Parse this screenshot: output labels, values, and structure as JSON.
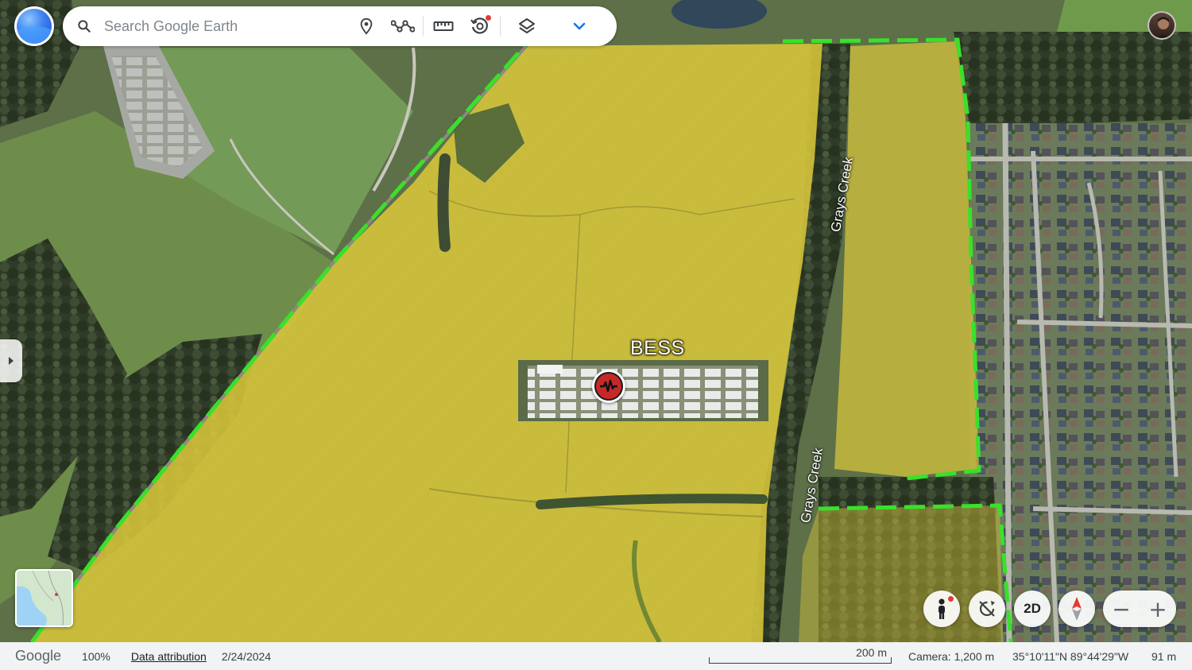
{
  "search": {
    "placeholder": "Search Google Earth"
  },
  "toolbar": {
    "placemark_icon": "pin-icon",
    "path_icon": "path-icon",
    "measure_icon": "ruler-icon",
    "history_icon": "history-icon",
    "layers_icon": "layers-icon",
    "expand_icon": "chevron-down-icon"
  },
  "map": {
    "project_label": "BESS",
    "creek_labels": [
      "Grays Creek",
      "Grays Creek"
    ],
    "boundary_color": "#39e12a",
    "overlay_color": "#e6d23a",
    "marker_color": "#c62828"
  },
  "controls": {
    "view_2d_label": "2D",
    "zoom_out": "−",
    "zoom_in": "+"
  },
  "status": {
    "logo": "Google",
    "zoom": "100%",
    "attribution": "Data attribution",
    "date": "2/24/2024",
    "scale": "200 m",
    "camera": "Camera: 1,200 m",
    "coordinates": "35°10'11\"N 89°44'29\"W",
    "elevation": "91 m"
  }
}
